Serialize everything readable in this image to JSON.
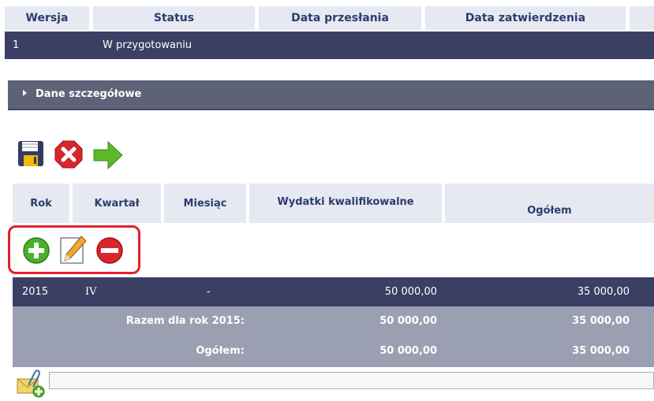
{
  "top_table": {
    "headers": [
      "Wersja",
      "Status",
      "Data przesłania",
      "Data zatwierdzenia"
    ],
    "row": {
      "wersja": "1",
      "status": "W przygotowaniu"
    }
  },
  "details_panel": {
    "label": "Dane szczegółowe"
  },
  "toolbar": {
    "icons": [
      "save-icon",
      "cancel-icon",
      "forward-arrow-icon"
    ]
  },
  "expense_table": {
    "headers": [
      "Rok",
      "Kwartał",
      "Miesiąc",
      "Wydatki kwalifikowalne",
      "Ogółem"
    ],
    "row_actions": [
      "add-icon",
      "edit-icon",
      "remove-icon"
    ],
    "rows": [
      {
        "rok": "2015",
        "kwartal": "IV",
        "miesiac": "-",
        "wydatki": "50 000,00",
        "ogolem": "35 000,00"
      }
    ],
    "subtotal": {
      "label": "Razem dla rok 2015:",
      "wydatki": "50 000,00",
      "ogolem": "35 000,00"
    },
    "total": {
      "label": "Ogółem:",
      "wydatki": "50 000,00",
      "ogolem": "35 000,00"
    }
  },
  "attachment": {
    "icon": "attachment-add-icon",
    "value": ""
  }
}
